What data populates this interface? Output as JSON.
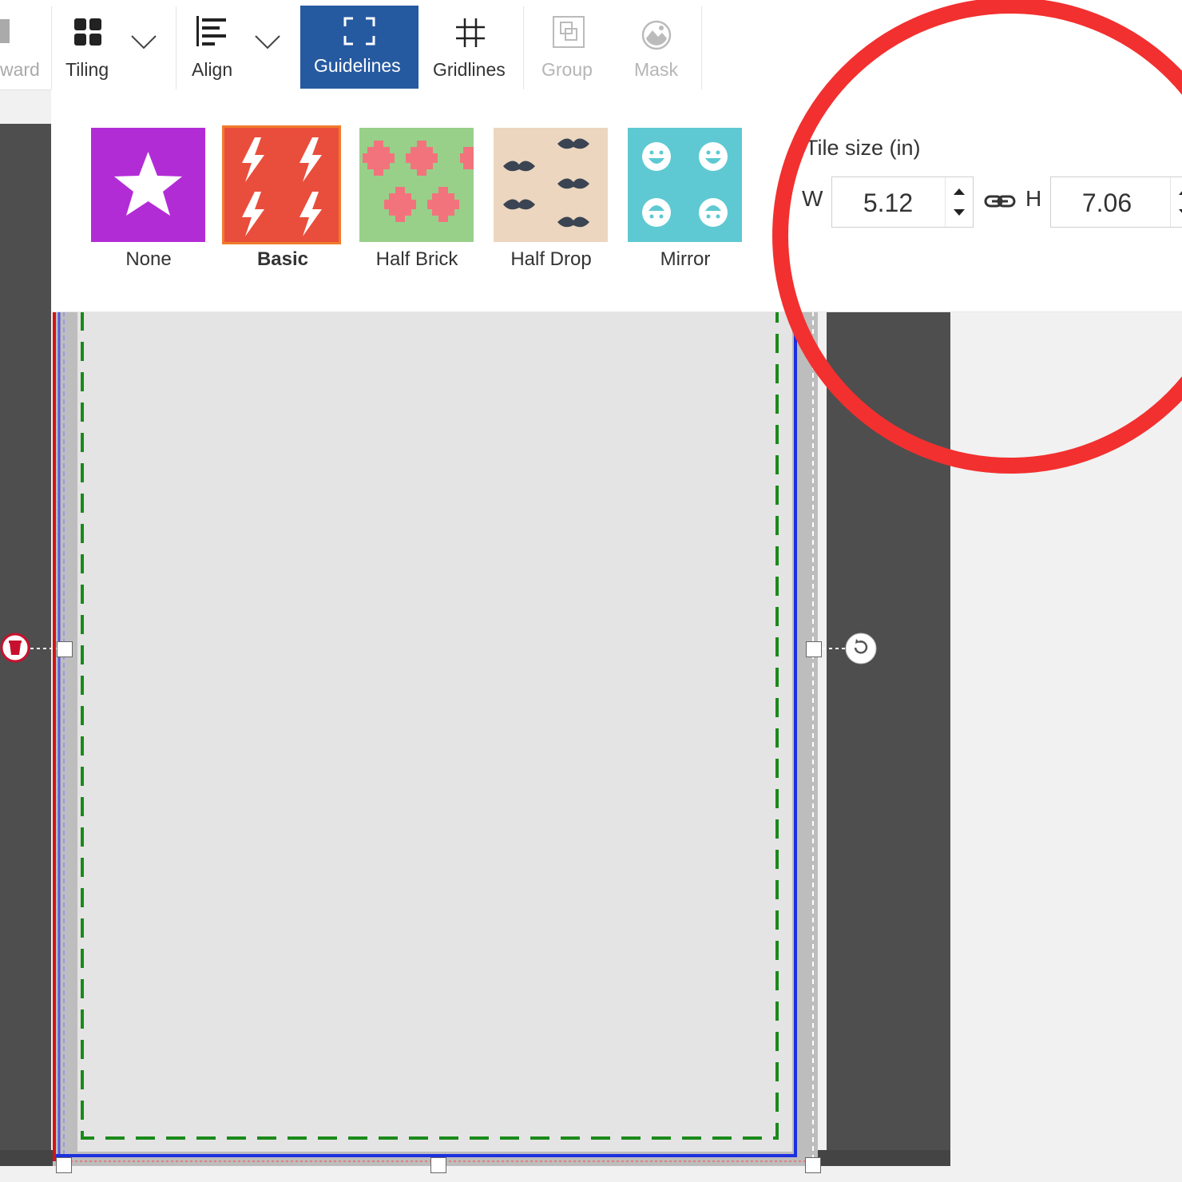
{
  "toolbar": {
    "forward_label": "ward",
    "tiling_label": "Tiling",
    "align_label": "Align",
    "guidelines_label": "Guidelines",
    "gridlines_label": "Gridlines",
    "group_label": "Group",
    "mask_label": "Mask",
    "active_color": "#265aa0"
  },
  "tiling_panel": {
    "patterns": [
      {
        "label": "None",
        "color": "#b22cd6",
        "selected": false
      },
      {
        "label": "Basic",
        "color": "#e94e3c",
        "selected": true
      },
      {
        "label": "Half Brick",
        "color": "#98d08a",
        "selected": false
      },
      {
        "label": "Half Drop",
        "color": "#ecd6bf",
        "selected": false
      },
      {
        "label": "Mirror",
        "color": "#5ec9d2",
        "selected": false
      }
    ],
    "tile_size": {
      "title": "Tile size (in)",
      "w_label": "W",
      "w_value": "5.12",
      "h_label": "H",
      "h_value": "7.06",
      "link_icon": "link-icon"
    }
  },
  "canvas": {
    "delete_icon": "trash-icon",
    "rotate_icon": "rotate-icon",
    "safe_line_color": "#1a8a1a",
    "bleed_line_color": "#1c2fe0",
    "cut_line_color": "#d31313"
  },
  "annotation": {
    "circle_color": "#f2302f"
  }
}
